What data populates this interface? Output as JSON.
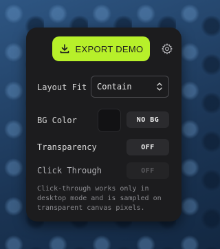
{
  "export_button": {
    "label": "EXPORT DEMO",
    "icon": "download-icon",
    "color": "#b7f02a"
  },
  "settings": {
    "icon": "gear-icon"
  },
  "layout_fit": {
    "label": "Layout Fit",
    "value": "Contain"
  },
  "bg_color": {
    "label": "BG Color",
    "swatch": "#121214",
    "button": "NO BG"
  },
  "transparency": {
    "label": "Transparency",
    "value": "OFF"
  },
  "click_through": {
    "label": "Click Through",
    "value": "OFF"
  },
  "note": "Click-through works only in desktop mode and is sampled on transparent canvas pixels."
}
